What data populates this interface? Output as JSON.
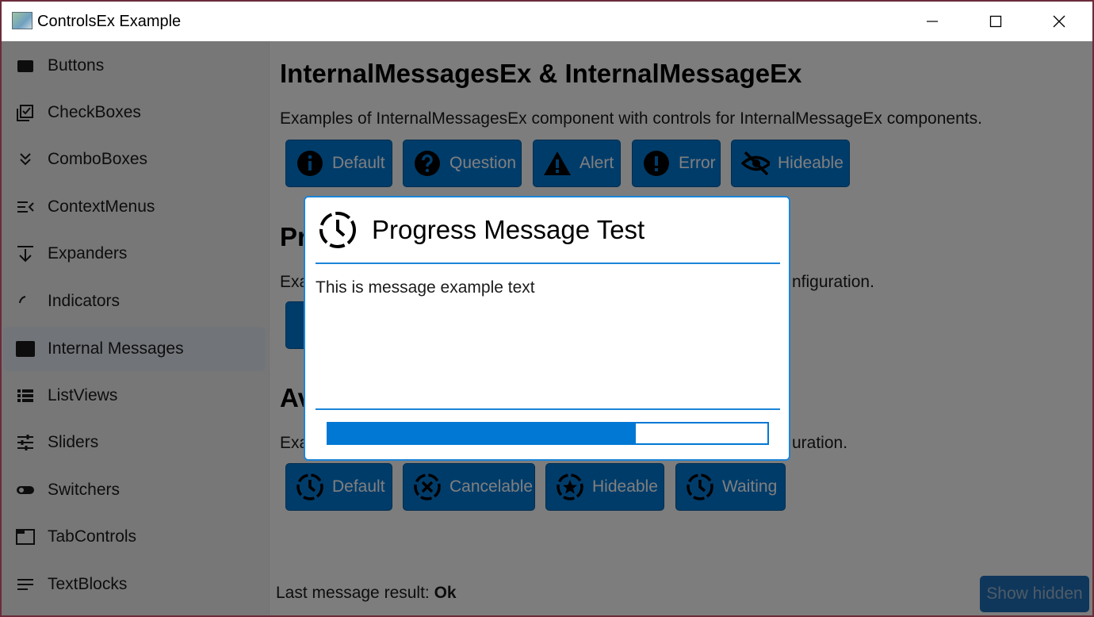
{
  "window": {
    "title": "ControlsEx Example"
  },
  "sidebar": {
    "items": [
      {
        "label": "Buttons",
        "icon": "button-icon"
      },
      {
        "label": "CheckBoxes",
        "icon": "checkbox-icon"
      },
      {
        "label": "ComboBoxes",
        "icon": "double-chevron-down-icon"
      },
      {
        "label": "ContextMenus",
        "icon": "menu-open-icon"
      },
      {
        "label": "Expanders",
        "icon": "expand-down-icon"
      },
      {
        "label": "Indicators",
        "icon": "arc-spinner-icon"
      },
      {
        "label": "Internal Messages",
        "icon": "window-icon",
        "selected": true
      },
      {
        "label": "ListViews",
        "icon": "list-icon"
      },
      {
        "label": "Sliders",
        "icon": "sliders-icon"
      },
      {
        "label": "Switchers",
        "icon": "toggle-icon"
      },
      {
        "label": "TabControls",
        "icon": "tab-icon"
      },
      {
        "label": "TextBlocks",
        "icon": "text-lines-icon"
      }
    ]
  },
  "main": {
    "heading": "InternalMessagesEx & InternalMessageEx",
    "description": "Examples of InternalMessagesEx component with controls for InternalMessageEx components.",
    "message_buttons": [
      "Default",
      "Question",
      "Alert",
      "Error",
      "Hideable"
    ],
    "progress_heading_partial": "Pr",
    "progress_description_left": "Exa",
    "progress_description_right": "nfiguration.",
    "await_heading_partial": "Av",
    "await_description_left": "Exa",
    "await_description_right": "uration.",
    "await_buttons": [
      "Default",
      "Cancelable",
      "Hideable",
      "Waiting"
    ],
    "footer_label": "Last message result: ",
    "footer_value": "Ok",
    "show_hidden_label": "Show hidden"
  },
  "dialog": {
    "title": "Progress Message Test",
    "message": "This is message example text",
    "progress_percent": 70
  },
  "colors": {
    "accent": "#0078d4",
    "selected_nav": "#e3e9f2"
  }
}
